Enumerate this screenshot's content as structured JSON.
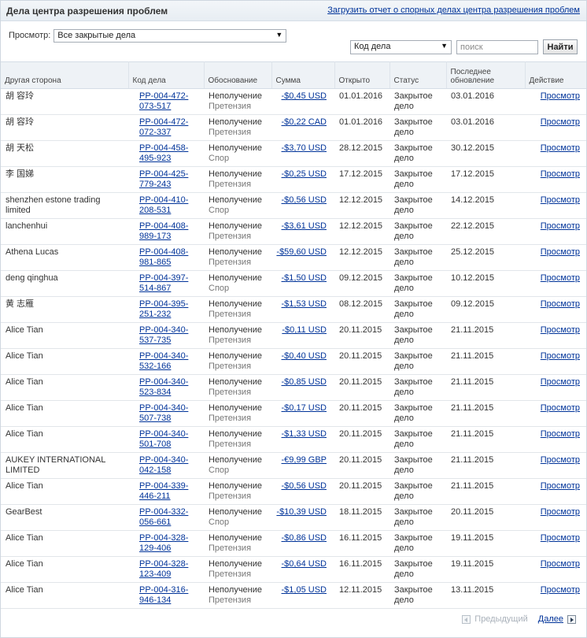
{
  "header": {
    "title": "Дела центра разрешения проблем",
    "report_link": "Загрузить отчет о спорных делах центра разрешения проблем"
  },
  "filter": {
    "label": "Просмотр:",
    "selected": "Все закрытые дела"
  },
  "search": {
    "type_selected": "Код дела",
    "placeholder": "поиск",
    "button": "Найти"
  },
  "columns": [
    "Другая сторона",
    "Код дела",
    "Обоснование",
    "Сумма",
    "Открыто",
    "Статус",
    "Последнее обновление",
    "Действие"
  ],
  "rows": [
    {
      "party": "胡 容玲",
      "case_id": "PP-004-472-073-517",
      "reason": "Неполучение",
      "subtype": "Претензия",
      "amount": "-$0,45 USD",
      "opened": "01.01.2016",
      "status": "Закрытое дело",
      "updated": "03.01.2016",
      "action": "Просмотр"
    },
    {
      "party": "胡 容玲",
      "case_id": "PP-004-472-072-337",
      "reason": "Неполучение",
      "subtype": "Претензия",
      "amount": "-$0,22 CAD",
      "opened": "01.01.2016",
      "status": "Закрытое дело",
      "updated": "03.01.2016",
      "action": "Просмотр"
    },
    {
      "party": "胡 天松",
      "case_id": "PP-004-458-495-923",
      "reason": "Неполучение",
      "subtype": "Спор",
      "amount": "-$3,70 USD",
      "opened": "28.12.2015",
      "status": "Закрытое дело",
      "updated": "30.12.2015",
      "action": "Просмотр"
    },
    {
      "party": "李 国娣",
      "case_id": "PP-004-425-779-243",
      "reason": "Неполучение",
      "subtype": "Претензия",
      "amount": "-$0,25 USD",
      "opened": "17.12.2015",
      "status": "Закрытое дело",
      "updated": "17.12.2015",
      "action": "Просмотр"
    },
    {
      "party": "shenzhen estone trading limited",
      "case_id": "PP-004-410-208-531",
      "reason": "Неполучение",
      "subtype": "Спор",
      "amount": "-$0,56 USD",
      "opened": "12.12.2015",
      "status": "Закрытое дело",
      "updated": "14.12.2015",
      "action": "Просмотр"
    },
    {
      "party": "lanchenhui",
      "case_id": "PP-004-408-989-173",
      "reason": "Неполучение",
      "subtype": "Претензия",
      "amount": "-$3,61 USD",
      "opened": "12.12.2015",
      "status": "Закрытое дело",
      "updated": "22.12.2015",
      "action": "Просмотр"
    },
    {
      "party": "Athena Lucas",
      "case_id": "PP-004-408-981-865",
      "reason": "Неполучение",
      "subtype": "Претензия",
      "amount": "-$59,60 USD",
      "opened": "12.12.2015",
      "status": "Закрытое дело",
      "updated": "25.12.2015",
      "action": "Просмотр"
    },
    {
      "party": "deng qinghua",
      "case_id": "PP-004-397-514-867",
      "reason": "Неполучение",
      "subtype": "Спор",
      "amount": "-$1,50 USD",
      "opened": "09.12.2015",
      "status": "Закрытое дело",
      "updated": "10.12.2015",
      "action": "Просмотр"
    },
    {
      "party": "黄 志雁",
      "case_id": "PP-004-395-251-232",
      "reason": "Неполучение",
      "subtype": "Претензия",
      "amount": "-$1,53 USD",
      "opened": "08.12.2015",
      "status": "Закрытое дело",
      "updated": "09.12.2015",
      "action": "Просмотр"
    },
    {
      "party": "Alice Tian",
      "case_id": "PP-004-340-537-735",
      "reason": "Неполучение",
      "subtype": "Претензия",
      "amount": "-$0,11 USD",
      "opened": "20.11.2015",
      "status": "Закрытое дело",
      "updated": "21.11.2015",
      "action": "Просмотр"
    },
    {
      "party": "Alice Tian",
      "case_id": "PP-004-340-532-166",
      "reason": "Неполучение",
      "subtype": "Претензия",
      "amount": "-$0,40 USD",
      "opened": "20.11.2015",
      "status": "Закрытое дело",
      "updated": "21.11.2015",
      "action": "Просмотр"
    },
    {
      "party": "Alice Tian",
      "case_id": "PP-004-340-523-834",
      "reason": "Неполучение",
      "subtype": "Претензия",
      "amount": "-$0,85 USD",
      "opened": "20.11.2015",
      "status": "Закрытое дело",
      "updated": "21.11.2015",
      "action": "Просмотр"
    },
    {
      "party": "Alice Tian",
      "case_id": "PP-004-340-507-738",
      "reason": "Неполучение",
      "subtype": "Претензия",
      "amount": "-$0,17 USD",
      "opened": "20.11.2015",
      "status": "Закрытое дело",
      "updated": "21.11.2015",
      "action": "Просмотр"
    },
    {
      "party": "Alice Tian",
      "case_id": "PP-004-340-501-708",
      "reason": "Неполучение",
      "subtype": "Претензия",
      "amount": "-$1,33 USD",
      "opened": "20.11.2015",
      "status": "Закрытое дело",
      "updated": "21.11.2015",
      "action": "Просмотр"
    },
    {
      "party": "AUKEY INTERNATIONAL LIMITED",
      "case_id": "PP-004-340-042-158",
      "reason": "Неполучение",
      "subtype": "Спор",
      "amount": "-€9,99 GBP",
      "opened": "20.11.2015",
      "status": "Закрытое дело",
      "updated": "21.11.2015",
      "action": "Просмотр"
    },
    {
      "party": "Alice Tian",
      "case_id": "PP-004-339-446-211",
      "reason": "Неполучение",
      "subtype": "Претензия",
      "amount": "-$0,56 USD",
      "opened": "20.11.2015",
      "status": "Закрытое дело",
      "updated": "21.11.2015",
      "action": "Просмотр"
    },
    {
      "party": "GearBest",
      "case_id": "PP-004-332-056-661",
      "reason": "Неполучение",
      "subtype": "Спор",
      "amount": "-$10,39 USD",
      "opened": "18.11.2015",
      "status": "Закрытое дело",
      "updated": "20.11.2015",
      "action": "Просмотр"
    },
    {
      "party": "Alice Tian",
      "case_id": "PP-004-328-129-406",
      "reason": "Неполучение",
      "subtype": "Претензия",
      "amount": "-$0,86 USD",
      "opened": "16.11.2015",
      "status": "Закрытое дело",
      "updated": "19.11.2015",
      "action": "Просмотр"
    },
    {
      "party": "Alice Tian",
      "case_id": "PP-004-328-123-409",
      "reason": "Неполучение",
      "subtype": "Претензия",
      "amount": "-$0,64 USD",
      "opened": "16.11.2015",
      "status": "Закрытое дело",
      "updated": "19.11.2015",
      "action": "Просмотр"
    },
    {
      "party": "Alice Tian",
      "case_id": "PP-004-316-946-134",
      "reason": "Неполучение",
      "subtype": "Претензия",
      "amount": "-$1,05 USD",
      "opened": "12.11.2015",
      "status": "Закрытое дело",
      "updated": "13.11.2015",
      "action": "Просмотр"
    }
  ],
  "pager": {
    "prev": "Предыдущий",
    "next": "Далее"
  },
  "colors": {
    "link": "#003399",
    "header_bg": "#eef2f6",
    "border": "#d5dde6"
  }
}
